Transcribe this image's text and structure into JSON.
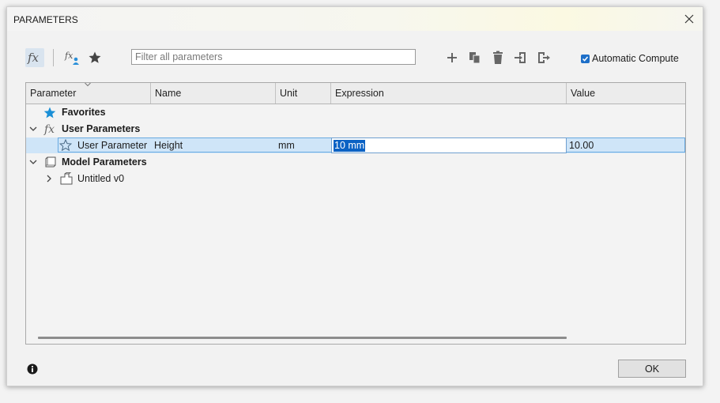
{
  "window": {
    "title": "PARAMETERS"
  },
  "toolbar": {
    "filter_placeholder": "Filter all parameters",
    "auto_compute_label": "Automatic Compute",
    "auto_compute_checked": true,
    "icons": [
      "fx-icon",
      "user-parameter-icon",
      "favorite-star-icon",
      "add-icon",
      "copy-icon",
      "delete-icon",
      "import-icon",
      "export-icon"
    ]
  },
  "table": {
    "columns": [
      "Parameter",
      "Name",
      "Unit",
      "Expression",
      "Value"
    ],
    "favorites_label": "Favorites",
    "user_params_label": "User Parameters",
    "user_param_row": {
      "parameter": "User Parameter",
      "name": "Height",
      "unit": "mm",
      "expression": "10 mm",
      "value": "10.00"
    },
    "model_params_label": "Model Parameters",
    "model_component": "Untitled v0"
  },
  "footer": {
    "ok_label": "OK"
  },
  "colors": {
    "accent": "#0b62c4",
    "selection": "#cfe5f8",
    "favorite_star": "#1a8fd6",
    "checkbox": "#1e6fc8"
  }
}
